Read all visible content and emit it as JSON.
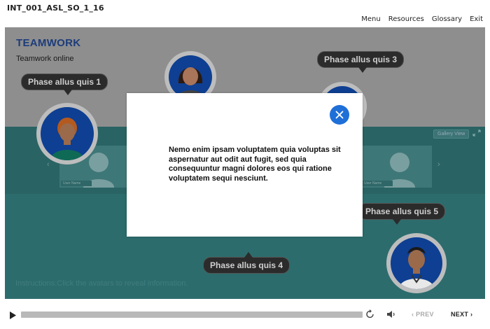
{
  "course_id": "INT_001_ASL_SO_1_16",
  "top_nav": {
    "menu": "Menu",
    "resources": "Resources",
    "glossary": "Glossary",
    "exit": "Exit"
  },
  "slide": {
    "title": "TEAMWORK",
    "subtitle": "Teamwork online",
    "phases": {
      "p1": "Phase allus quis 1",
      "p3": "Phase allus quis 3",
      "p4": "Phase allus quis 4",
      "p5": "Phase allus quis 5"
    },
    "video_panel": {
      "gallery_view": "Gallery View",
      "tile_name_1": "User Name",
      "tile_name_2": "User Name"
    },
    "instructions": "Instructions:Click the avatars to reveal information."
  },
  "modal": {
    "text": "Nemo enim ipsam voluptatem quia voluptas sit aspernatur aut odit aut fugit, sed quia consequuntur magni dolores eos qui ratione voluptatem sequi nesciunt."
  },
  "player": {
    "prev_label": "PREV",
    "next_label": "NEXT"
  },
  "colors": {
    "title_blue": "#1d3c7a",
    "teal": "#2d6c6d",
    "close_button_blue": "#1f6fd8",
    "bubble_dark": "#2b2b2b"
  }
}
